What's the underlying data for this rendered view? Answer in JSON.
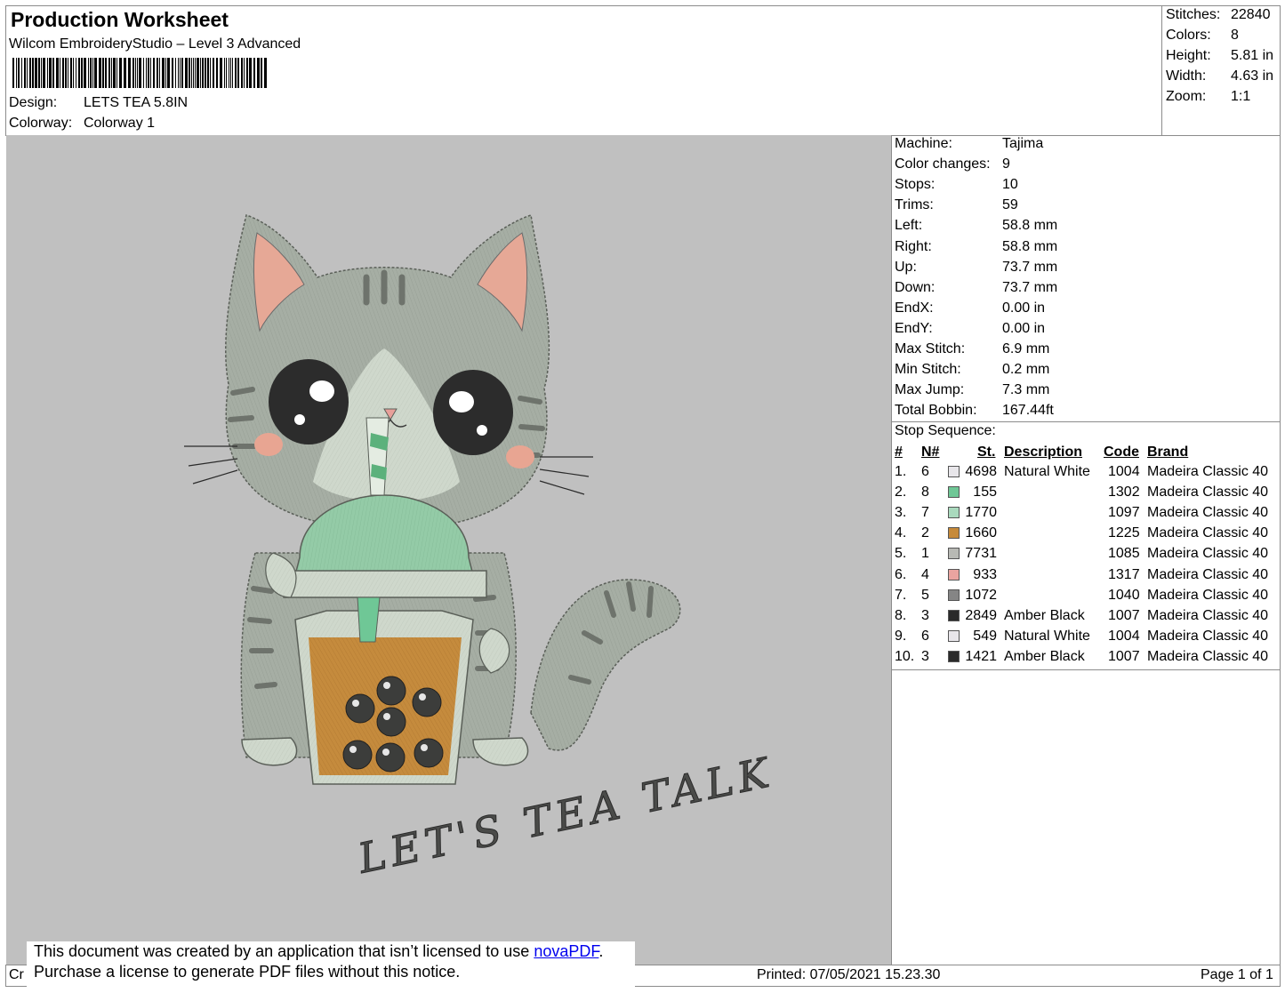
{
  "header": {
    "title": "Production Worksheet",
    "subtitle": "Wilcom EmbroideryStudio – Level 3 Advanced",
    "design_label": "Design:",
    "design_value": "LETS TEA 5.8IN",
    "colorway_label": "Colorway:",
    "colorway_value": "Colorway 1"
  },
  "summary": [
    {
      "label": "Stitches:",
      "value": "22840"
    },
    {
      "label": "Colors:",
      "value": "8"
    },
    {
      "label": "Height:",
      "value": "5.81 in"
    },
    {
      "label": "Width:",
      "value": "4.63 in"
    },
    {
      "label": "Zoom:",
      "value": "1:1"
    }
  ],
  "machine_stats": [
    {
      "label": "Machine:",
      "value": "Tajima"
    },
    {
      "label": "Color changes:",
      "value": "9"
    },
    {
      "label": "Stops:",
      "value": "10"
    },
    {
      "label": "Trims:",
      "value": "59"
    },
    {
      "label": "Left:",
      "value": "58.8 mm"
    },
    {
      "label": "Right:",
      "value": "58.8 mm"
    },
    {
      "label": "Up:",
      "value": "73.7 mm"
    },
    {
      "label": "Down:",
      "value": "73.7 mm"
    },
    {
      "label": "EndX:",
      "value": "0.00 in"
    },
    {
      "label": "EndY:",
      "value": "0.00 in"
    },
    {
      "label": "Max Stitch:",
      "value": "6.9 mm"
    },
    {
      "label": "Min Stitch:",
      "value": "0.2 mm"
    },
    {
      "label": "Max Jump:",
      "value": "7.3 mm"
    },
    {
      "label": "Total Bobbin:",
      "value": "167.44ft"
    }
  ],
  "stop_sequence": {
    "title": "Stop Sequence:",
    "headers": {
      "num": "#",
      "n": "N#",
      "st": "St.",
      "desc": "Description",
      "code": "Code",
      "brand": "Brand"
    },
    "rows": [
      {
        "num": "1.",
        "n": "6",
        "color": "#e8e6ea",
        "st": "4698",
        "desc": "Natural White",
        "code": "1004",
        "brand": "Madeira Classic 40"
      },
      {
        "num": "2.",
        "n": "8",
        "color": "#6fc796",
        "st": "155",
        "desc": "",
        "code": "1302",
        "brand": "Madeira Classic 40"
      },
      {
        "num": "3.",
        "n": "7",
        "color": "#a9d9bd",
        "st": "1770",
        "desc": "",
        "code": "1097",
        "brand": "Madeira Classic 40"
      },
      {
        "num": "4.",
        "n": "2",
        "color": "#c68a3a",
        "st": "1660",
        "desc": "",
        "code": "1225",
        "brand": "Madeira Classic 40"
      },
      {
        "num": "5.",
        "n": "1",
        "color": "#b8b9b4",
        "st": "7731",
        "desc": "",
        "code": "1085",
        "brand": "Madeira Classic 40"
      },
      {
        "num": "6.",
        "n": "4",
        "color": "#eaa4a0",
        "st": "933",
        "desc": "",
        "code": "1317",
        "brand": "Madeira Classic 40"
      },
      {
        "num": "7.",
        "n": "5",
        "color": "#858585",
        "st": "1072",
        "desc": "",
        "code": "1040",
        "brand": "Madeira Classic 40"
      },
      {
        "num": "8.",
        "n": "3",
        "color": "#2a2a2a",
        "st": "2849",
        "desc": "Amber Black",
        "code": "1007",
        "brand": "Madeira Classic 40"
      },
      {
        "num": "9.",
        "n": "6",
        "color": "#e8e6ea",
        "st": "549",
        "desc": "Natural White",
        "code": "1004",
        "brand": "Madeira Classic 40"
      },
      {
        "num": "10.",
        "n": "3",
        "color": "#2a2a2a",
        "st": "1421",
        "desc": "Amber Black",
        "code": "1007",
        "brand": "Madeira Classic 40"
      }
    ]
  },
  "design_text": "LET'S TEA TALK",
  "footer": {
    "left": "Cr",
    "printed": "Printed: 07/05/2021 15.23.30",
    "page": "Page 1 of 1"
  },
  "notice": {
    "line1_before": "This document was created by an application that isn’t licensed to use ",
    "link": "novaPDF",
    "line1_after": ".",
    "line2": "Purchase a license to generate PDF files without this notice."
  }
}
